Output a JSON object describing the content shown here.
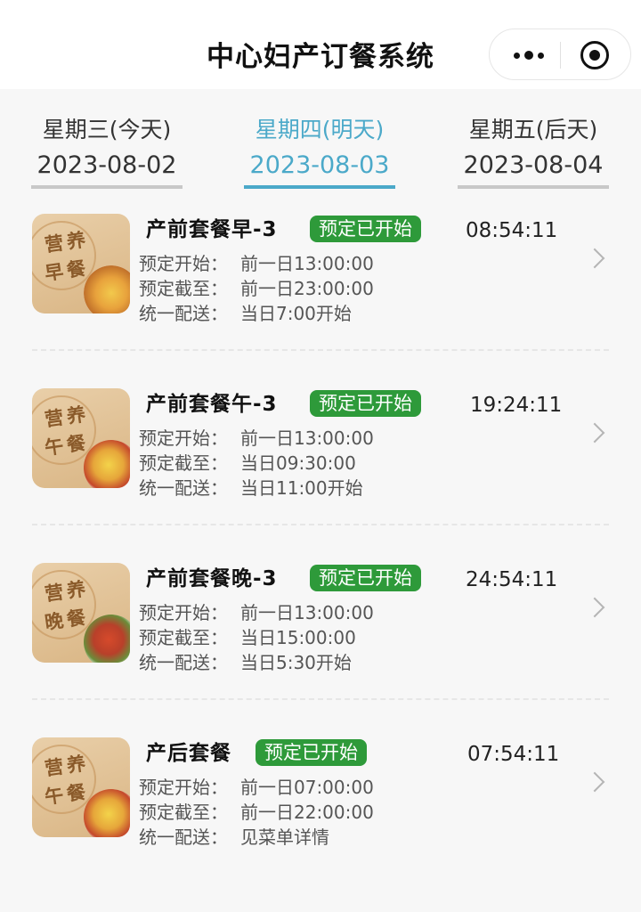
{
  "header": {
    "title": "中心妇产订餐系统"
  },
  "tabs": [
    {
      "weekday": "星期三(今天)",
      "date": "2023-08-02",
      "active": false
    },
    {
      "weekday": "星期四(明天)",
      "date": "2023-08-03",
      "active": true
    },
    {
      "weekday": "星期五(后天)",
      "date": "2023-08-04",
      "active": false
    }
  ],
  "labels": {
    "start": "预定开始：",
    "end": "预定截至：",
    "delivery": "统一配送："
  },
  "meals": [
    {
      "name": "产前套餐早-3",
      "badge": "预定已开始",
      "countdown": "08:54:11",
      "thumb_line1": "营养",
      "thumb_line2": "早餐",
      "start": "前一日13:00:00",
      "end": "前一日23:00:00",
      "delivery": "当日7:00开始"
    },
    {
      "name": "产前套餐午-3",
      "badge": "预定已开始",
      "countdown": "19:24:11",
      "thumb_line1": "营养",
      "thumb_line2": "午餐",
      "start": "前一日13:00:00",
      "end": "当日09:30:00",
      "delivery": "当日11:00开始"
    },
    {
      "name": "产前套餐晚-3",
      "badge": "预定已开始",
      "countdown": "24:54:11",
      "thumb_line1": "营养",
      "thumb_line2": "晚餐",
      "start": "前一日13:00:00",
      "end": "当日15:00:00",
      "delivery": "当日5:30开始"
    },
    {
      "name": "产后套餐",
      "badge": "预定已开始",
      "countdown": "07:54:11",
      "thumb_line1": "营养",
      "thumb_line2": "午餐",
      "start": "前一日07:00:00",
      "end": "前一日22:00:00",
      "delivery": "见菜单详情"
    }
  ]
}
